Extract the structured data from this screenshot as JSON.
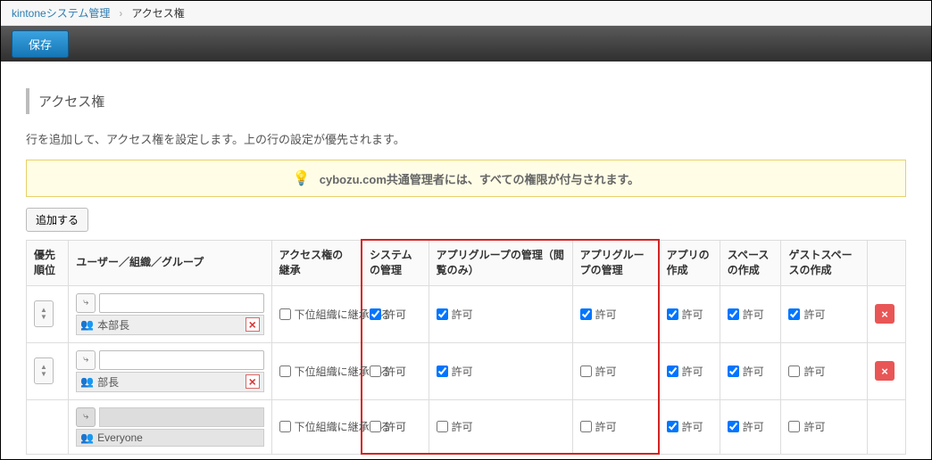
{
  "breadcrumb": {
    "root_label": "kintoneシステム管理",
    "current_label": "アクセス権"
  },
  "actionbar": {
    "save_label": "保存"
  },
  "section": {
    "title": "アクセス権",
    "instruction": "行を追加して、アクセス権を設定します。上の行の設定が優先されます。",
    "notice": "cybozu.com共通管理者には、すべての権限が付与されます。",
    "add_button_label": "追加する"
  },
  "table": {
    "headers": {
      "priority": "優先順位",
      "user": "ユーザー／組織／グループ",
      "inherit": "アクセス権の継承",
      "system": "システムの管理",
      "appgroup_view": "アプリグループの管理（閲覧のみ）",
      "appgroup_manage": "アプリグループの管理",
      "app_create": "アプリの作成",
      "space_create": "スペースの作成",
      "guest_create": "ゲストスペースの作成"
    },
    "inherit_label": "下位組織に継承する",
    "permit_label": "許可",
    "rows": [
      {
        "has_input": true,
        "org_name": "本部長",
        "removable": true,
        "inherit": false,
        "system": true,
        "appgroup_view": true,
        "appgroup_manage": true,
        "app_create": true,
        "space_create": true,
        "guest_create": true,
        "deletable": true
      },
      {
        "has_input": true,
        "org_name": "部長",
        "removable": true,
        "inherit": false,
        "system": false,
        "appgroup_view": true,
        "appgroup_manage": false,
        "app_create": true,
        "space_create": true,
        "guest_create": false,
        "deletable": true
      },
      {
        "has_input": false,
        "org_name": "Everyone",
        "removable": false,
        "inherit": false,
        "system": false,
        "appgroup_view": false,
        "appgroup_manage": false,
        "app_create": true,
        "space_create": true,
        "guest_create": false,
        "deletable": false
      }
    ]
  }
}
